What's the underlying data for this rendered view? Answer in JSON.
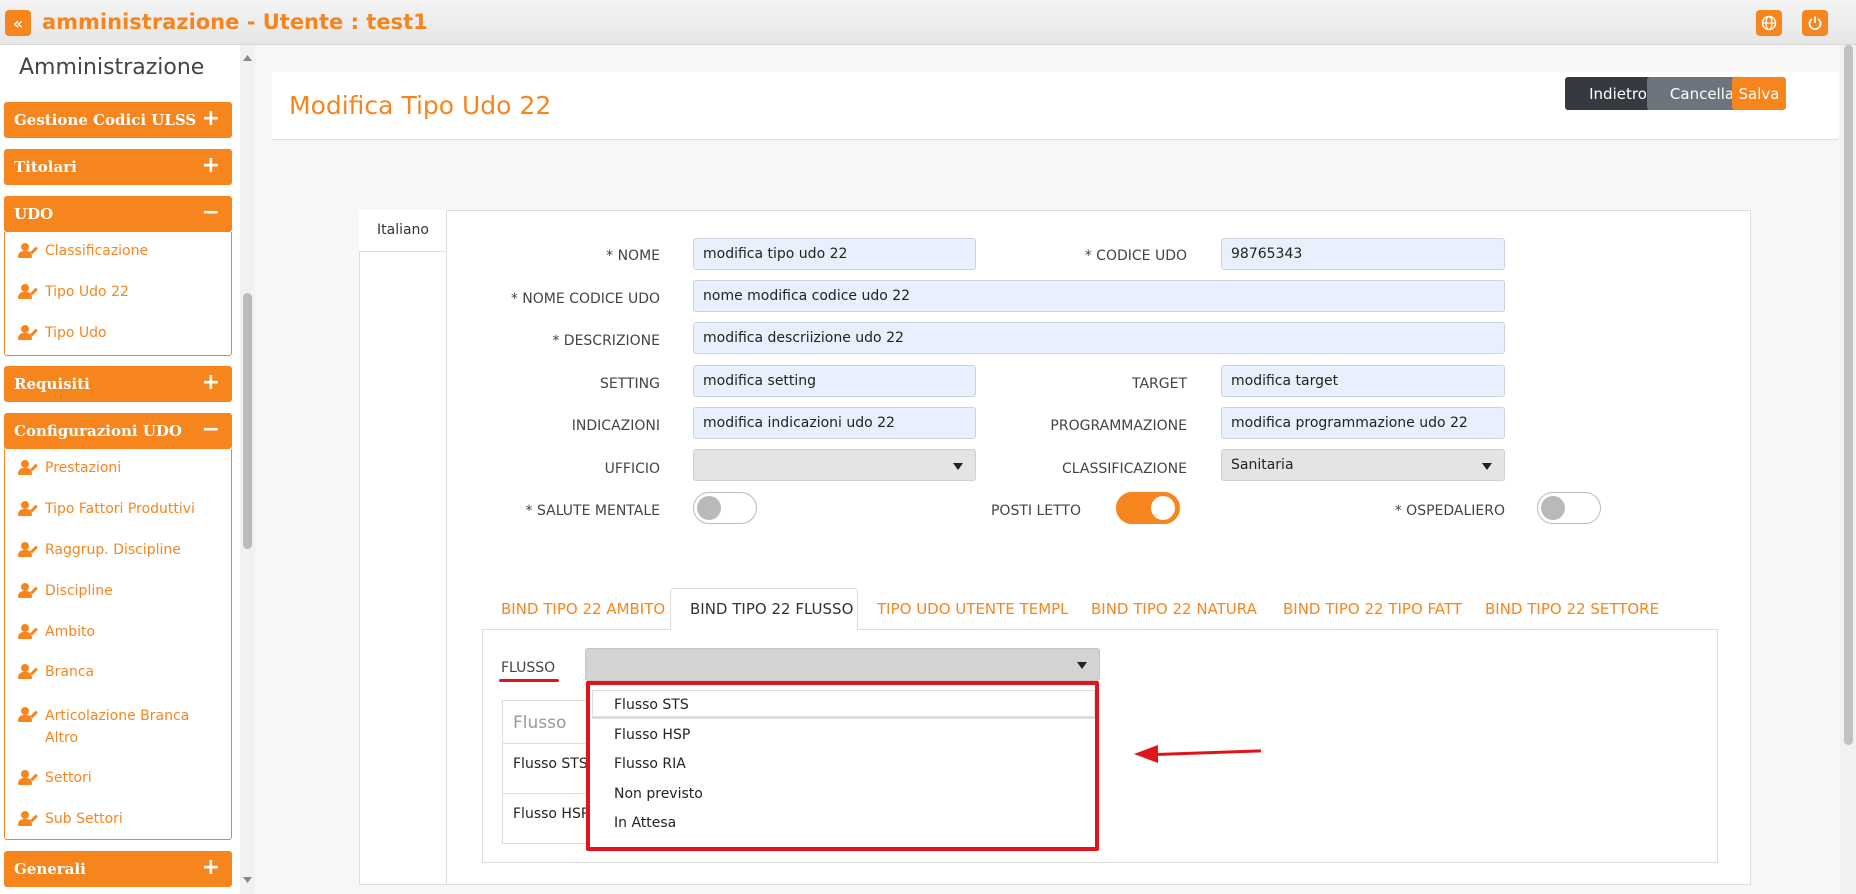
{
  "header": {
    "title": "amministrazione - Utente : test1",
    "collapse_icon": "double-chevron-left-icon",
    "globe_icon": "globe-icon",
    "power_icon": "power-icon"
  },
  "sidebar": {
    "title": "Amministrazione",
    "sections": [
      {
        "label": "Gestione Codici ULSS",
        "toggle": "+"
      },
      {
        "label": "Titolari",
        "toggle": "+"
      },
      {
        "label": "UDO",
        "toggle": "−",
        "items": [
          "Classificazione",
          "Tipo Udo 22",
          "Tipo Udo"
        ]
      },
      {
        "label": "Requisiti",
        "toggle": "+"
      },
      {
        "label": "Configurazioni UDO",
        "toggle": "−",
        "items": [
          "Prestazioni",
          "Tipo Fattori Produttivi",
          "Raggrup. Discipline",
          "Discipline",
          "Ambito",
          "Branca",
          "Articolazione Branca Altro",
          "Settori",
          "Sub Settori"
        ]
      },
      {
        "label": "Generali",
        "toggle": "+"
      }
    ]
  },
  "page": {
    "title": "Modifica Tipo Udo 22",
    "buttons": {
      "back": "Indietro",
      "cancel": "Cancella",
      "save": "Salva"
    },
    "lang_tab": "Italiano"
  },
  "form": {
    "nome": {
      "label": "* NOME",
      "value": "modifica tipo udo 22"
    },
    "codice_udo": {
      "label": "* CODICE UDO",
      "value": "98765343"
    },
    "nome_codice_udo": {
      "label": "* NOME CODICE UDO",
      "value": "nome modifica codice udo 22"
    },
    "descrizione": {
      "label": "* DESCRIZIONE",
      "value": "modifica descriizione udo 22"
    },
    "setting": {
      "label": "SETTING",
      "value": "modifica setting"
    },
    "target": {
      "label": "TARGET",
      "value": "modifica target"
    },
    "indicazioni": {
      "label": "INDICAZIONI",
      "value": "modifica indicazioni udo 22"
    },
    "programmazione": {
      "label": "PROGRAMMAZIONE",
      "value": "modifica programmazione udo 22"
    },
    "ufficio": {
      "label": "UFFICIO",
      "value": ""
    },
    "classificazione": {
      "label": "CLASSIFICAZIONE",
      "value": "Sanitaria"
    },
    "salute_mentale": {
      "label": "* SALUTE MENTALE",
      "on": false
    },
    "posti_letto": {
      "label": "POSTI LETTO",
      "on": true
    },
    "ospedaliero": {
      "label": "* OSPEDALIERO",
      "on": false
    }
  },
  "tabs": [
    "BIND TIPO 22 AMBITO",
    "BIND TIPO 22 FLUSSO",
    "TIPO UDO UTENTE TEMPL",
    "BIND TIPO 22 NATURA",
    "BIND TIPO 22 TIPO FATT",
    "BIND TIPO 22 SETTORE"
  ],
  "active_tab": "BIND TIPO 22 FLUSSO",
  "flusso": {
    "label": "FLUSSO",
    "selected": "",
    "options": [
      "Flusso STS",
      "Flusso HSP",
      "Flusso RIA",
      "Non previsto",
      "In Attesa"
    ],
    "table": {
      "header": "Flusso",
      "rows": [
        "Flusso STS",
        "Flusso HSP"
      ]
    }
  },
  "colors": {
    "accent": "#f7851e",
    "annotation": "#e3131b",
    "dark_button": "#343a40",
    "grey_button": "#6c757d"
  }
}
